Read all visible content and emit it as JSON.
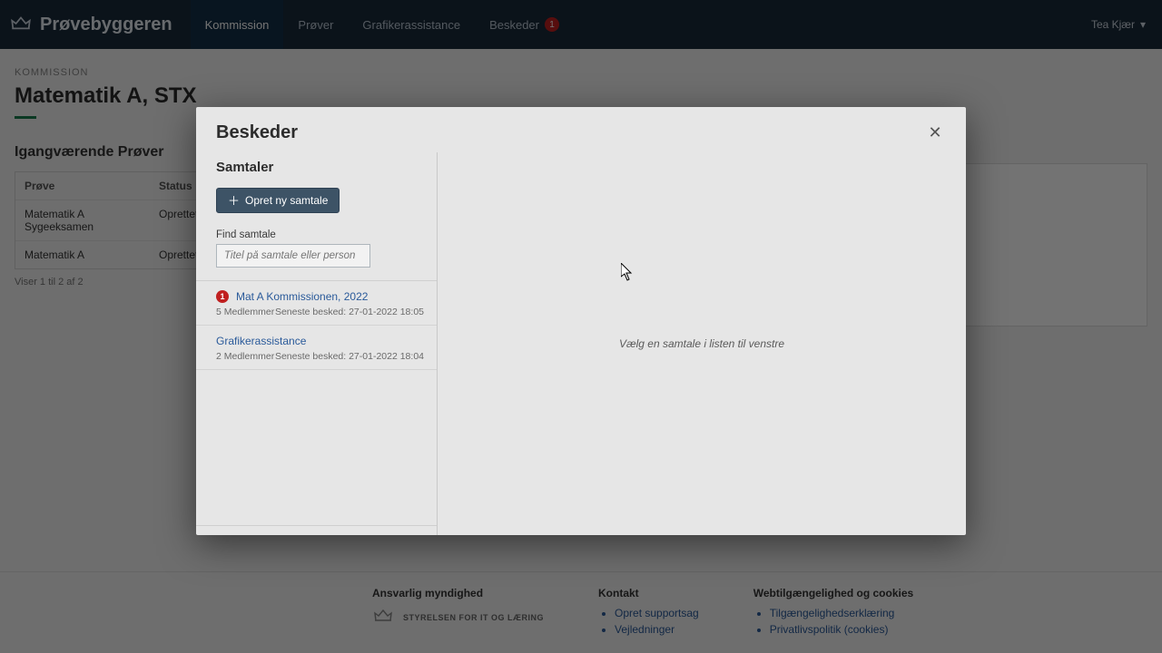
{
  "brand": {
    "name": "Prøvebyggeren"
  },
  "nav": {
    "items": [
      {
        "label": "Kommission",
        "active": true
      },
      {
        "label": "Prøver"
      },
      {
        "label": "Grafikerassistance"
      },
      {
        "label": "Beskeder",
        "badge": "1"
      }
    ]
  },
  "user": {
    "name": "Tea Kjær"
  },
  "page": {
    "eyebrow": "KOMMISSION",
    "title": "Matematik A, STX",
    "section": "Igangværende Prøver"
  },
  "table": {
    "headers": {
      "prove": "Prøve",
      "status": "Status"
    },
    "rows": [
      {
        "prove": "Matematik A Sygeeksamen",
        "status": "Oprettet"
      },
      {
        "prove": "Matematik A",
        "status": "Oprettet"
      }
    ],
    "pager": "Viser 1 til 2 af 2"
  },
  "footer": {
    "col1": {
      "title": "Ansvarlig myndighed",
      "agency": "STYRELSEN FOR IT OG LÆRING"
    },
    "col2": {
      "title": "Kontakt",
      "links": [
        "Opret supportsag",
        "Vejledninger"
      ]
    },
    "col3": {
      "title": "Webtilgængelighed og cookies",
      "links": [
        "Tilgængelighedserklæring",
        "Privatlivspolitik (cookies)"
      ]
    }
  },
  "modal": {
    "title": "Beskeder",
    "side": {
      "heading": "Samtaler",
      "new_button": "Opret ny samtale",
      "find_label": "Find samtale",
      "find_placeholder": "Titel på samtale eller person"
    },
    "conversations": [
      {
        "badge": "1",
        "title": "Mat A Kommissionen, 2022",
        "members": "5 Medlemmer",
        "latest": "Seneste besked: 27-01-2022 18:05"
      },
      {
        "title": "Grafikerassistance",
        "members": "2 Medlemmer",
        "latest": "Seneste besked: 27-01-2022 18:04"
      }
    ],
    "empty_main": "Vælg en samtale i listen til venstre"
  }
}
